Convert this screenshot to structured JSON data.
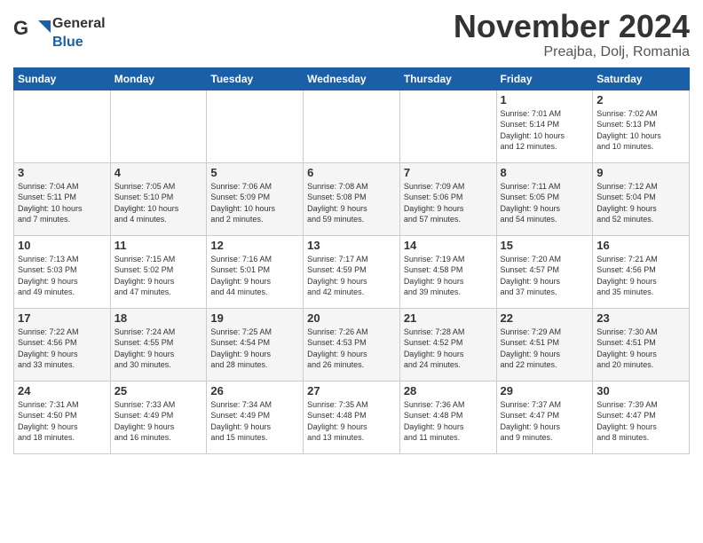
{
  "logo": {
    "general": "General",
    "blue": "Blue"
  },
  "header": {
    "month": "November 2024",
    "location": "Preajba, Dolj, Romania"
  },
  "days_of_week": [
    "Sunday",
    "Monday",
    "Tuesday",
    "Wednesday",
    "Thursday",
    "Friday",
    "Saturday"
  ],
  "weeks": [
    [
      {
        "day": "",
        "info": ""
      },
      {
        "day": "",
        "info": ""
      },
      {
        "day": "",
        "info": ""
      },
      {
        "day": "",
        "info": ""
      },
      {
        "day": "",
        "info": ""
      },
      {
        "day": "1",
        "info": "Sunrise: 7:01 AM\nSunset: 5:14 PM\nDaylight: 10 hours\nand 12 minutes."
      },
      {
        "day": "2",
        "info": "Sunrise: 7:02 AM\nSunset: 5:13 PM\nDaylight: 10 hours\nand 10 minutes."
      }
    ],
    [
      {
        "day": "3",
        "info": "Sunrise: 7:04 AM\nSunset: 5:11 PM\nDaylight: 10 hours\nand 7 minutes."
      },
      {
        "day": "4",
        "info": "Sunrise: 7:05 AM\nSunset: 5:10 PM\nDaylight: 10 hours\nand 4 minutes."
      },
      {
        "day": "5",
        "info": "Sunrise: 7:06 AM\nSunset: 5:09 PM\nDaylight: 10 hours\nand 2 minutes."
      },
      {
        "day": "6",
        "info": "Sunrise: 7:08 AM\nSunset: 5:08 PM\nDaylight: 9 hours\nand 59 minutes."
      },
      {
        "day": "7",
        "info": "Sunrise: 7:09 AM\nSunset: 5:06 PM\nDaylight: 9 hours\nand 57 minutes."
      },
      {
        "day": "8",
        "info": "Sunrise: 7:11 AM\nSunset: 5:05 PM\nDaylight: 9 hours\nand 54 minutes."
      },
      {
        "day": "9",
        "info": "Sunrise: 7:12 AM\nSunset: 5:04 PM\nDaylight: 9 hours\nand 52 minutes."
      }
    ],
    [
      {
        "day": "10",
        "info": "Sunrise: 7:13 AM\nSunset: 5:03 PM\nDaylight: 9 hours\nand 49 minutes."
      },
      {
        "day": "11",
        "info": "Sunrise: 7:15 AM\nSunset: 5:02 PM\nDaylight: 9 hours\nand 47 minutes."
      },
      {
        "day": "12",
        "info": "Sunrise: 7:16 AM\nSunset: 5:01 PM\nDaylight: 9 hours\nand 44 minutes."
      },
      {
        "day": "13",
        "info": "Sunrise: 7:17 AM\nSunset: 4:59 PM\nDaylight: 9 hours\nand 42 minutes."
      },
      {
        "day": "14",
        "info": "Sunrise: 7:19 AM\nSunset: 4:58 PM\nDaylight: 9 hours\nand 39 minutes."
      },
      {
        "day": "15",
        "info": "Sunrise: 7:20 AM\nSunset: 4:57 PM\nDaylight: 9 hours\nand 37 minutes."
      },
      {
        "day": "16",
        "info": "Sunrise: 7:21 AM\nSunset: 4:56 PM\nDaylight: 9 hours\nand 35 minutes."
      }
    ],
    [
      {
        "day": "17",
        "info": "Sunrise: 7:22 AM\nSunset: 4:56 PM\nDaylight: 9 hours\nand 33 minutes."
      },
      {
        "day": "18",
        "info": "Sunrise: 7:24 AM\nSunset: 4:55 PM\nDaylight: 9 hours\nand 30 minutes."
      },
      {
        "day": "19",
        "info": "Sunrise: 7:25 AM\nSunset: 4:54 PM\nDaylight: 9 hours\nand 28 minutes."
      },
      {
        "day": "20",
        "info": "Sunrise: 7:26 AM\nSunset: 4:53 PM\nDaylight: 9 hours\nand 26 minutes."
      },
      {
        "day": "21",
        "info": "Sunrise: 7:28 AM\nSunset: 4:52 PM\nDaylight: 9 hours\nand 24 minutes."
      },
      {
        "day": "22",
        "info": "Sunrise: 7:29 AM\nSunset: 4:51 PM\nDaylight: 9 hours\nand 22 minutes."
      },
      {
        "day": "23",
        "info": "Sunrise: 7:30 AM\nSunset: 4:51 PM\nDaylight: 9 hours\nand 20 minutes."
      }
    ],
    [
      {
        "day": "24",
        "info": "Sunrise: 7:31 AM\nSunset: 4:50 PM\nDaylight: 9 hours\nand 18 minutes."
      },
      {
        "day": "25",
        "info": "Sunrise: 7:33 AM\nSunset: 4:49 PM\nDaylight: 9 hours\nand 16 minutes."
      },
      {
        "day": "26",
        "info": "Sunrise: 7:34 AM\nSunset: 4:49 PM\nDaylight: 9 hours\nand 15 minutes."
      },
      {
        "day": "27",
        "info": "Sunrise: 7:35 AM\nSunset: 4:48 PM\nDaylight: 9 hours\nand 13 minutes."
      },
      {
        "day": "28",
        "info": "Sunrise: 7:36 AM\nSunset: 4:48 PM\nDaylight: 9 hours\nand 11 minutes."
      },
      {
        "day": "29",
        "info": "Sunrise: 7:37 AM\nSunset: 4:47 PM\nDaylight: 9 hours\nand 9 minutes."
      },
      {
        "day": "30",
        "info": "Sunrise: 7:39 AM\nSunset: 4:47 PM\nDaylight: 9 hours\nand 8 minutes."
      }
    ]
  ]
}
